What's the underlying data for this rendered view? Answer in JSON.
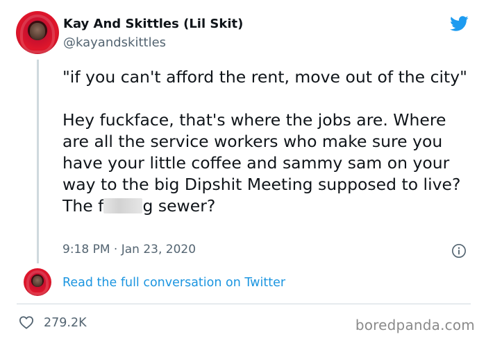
{
  "author": {
    "display_name": "Kay And Skittles (Lil Skit)",
    "handle": "@kayandskittles"
  },
  "tweet": {
    "paragraph_1": "\"if you can't afford the rent, move out of the city\"",
    "paragraph_2_before_censor": "Hey fuckface, that's where the jobs are. Where are all the service workers who make sure you have your little coffee and sammy sam on your way to the big Dipshit Meeting supposed to live? The f",
    "paragraph_2_after_censor": "g sewer?",
    "timestamp": "9:18 PM · Jan 23, 2020"
  },
  "conversation_link": "Read the full conversation on Twitter",
  "likes_count": "279.2K",
  "watermark": "boredpanda.com",
  "icons": {
    "brand": "twitter-bird-icon",
    "info": "info-icon",
    "like": "heart-icon"
  },
  "colors": {
    "twitter_blue": "#1d9bf0",
    "link_blue": "#1b95e0",
    "secondary_text": "#536471",
    "thread_line": "#cfd9de"
  }
}
